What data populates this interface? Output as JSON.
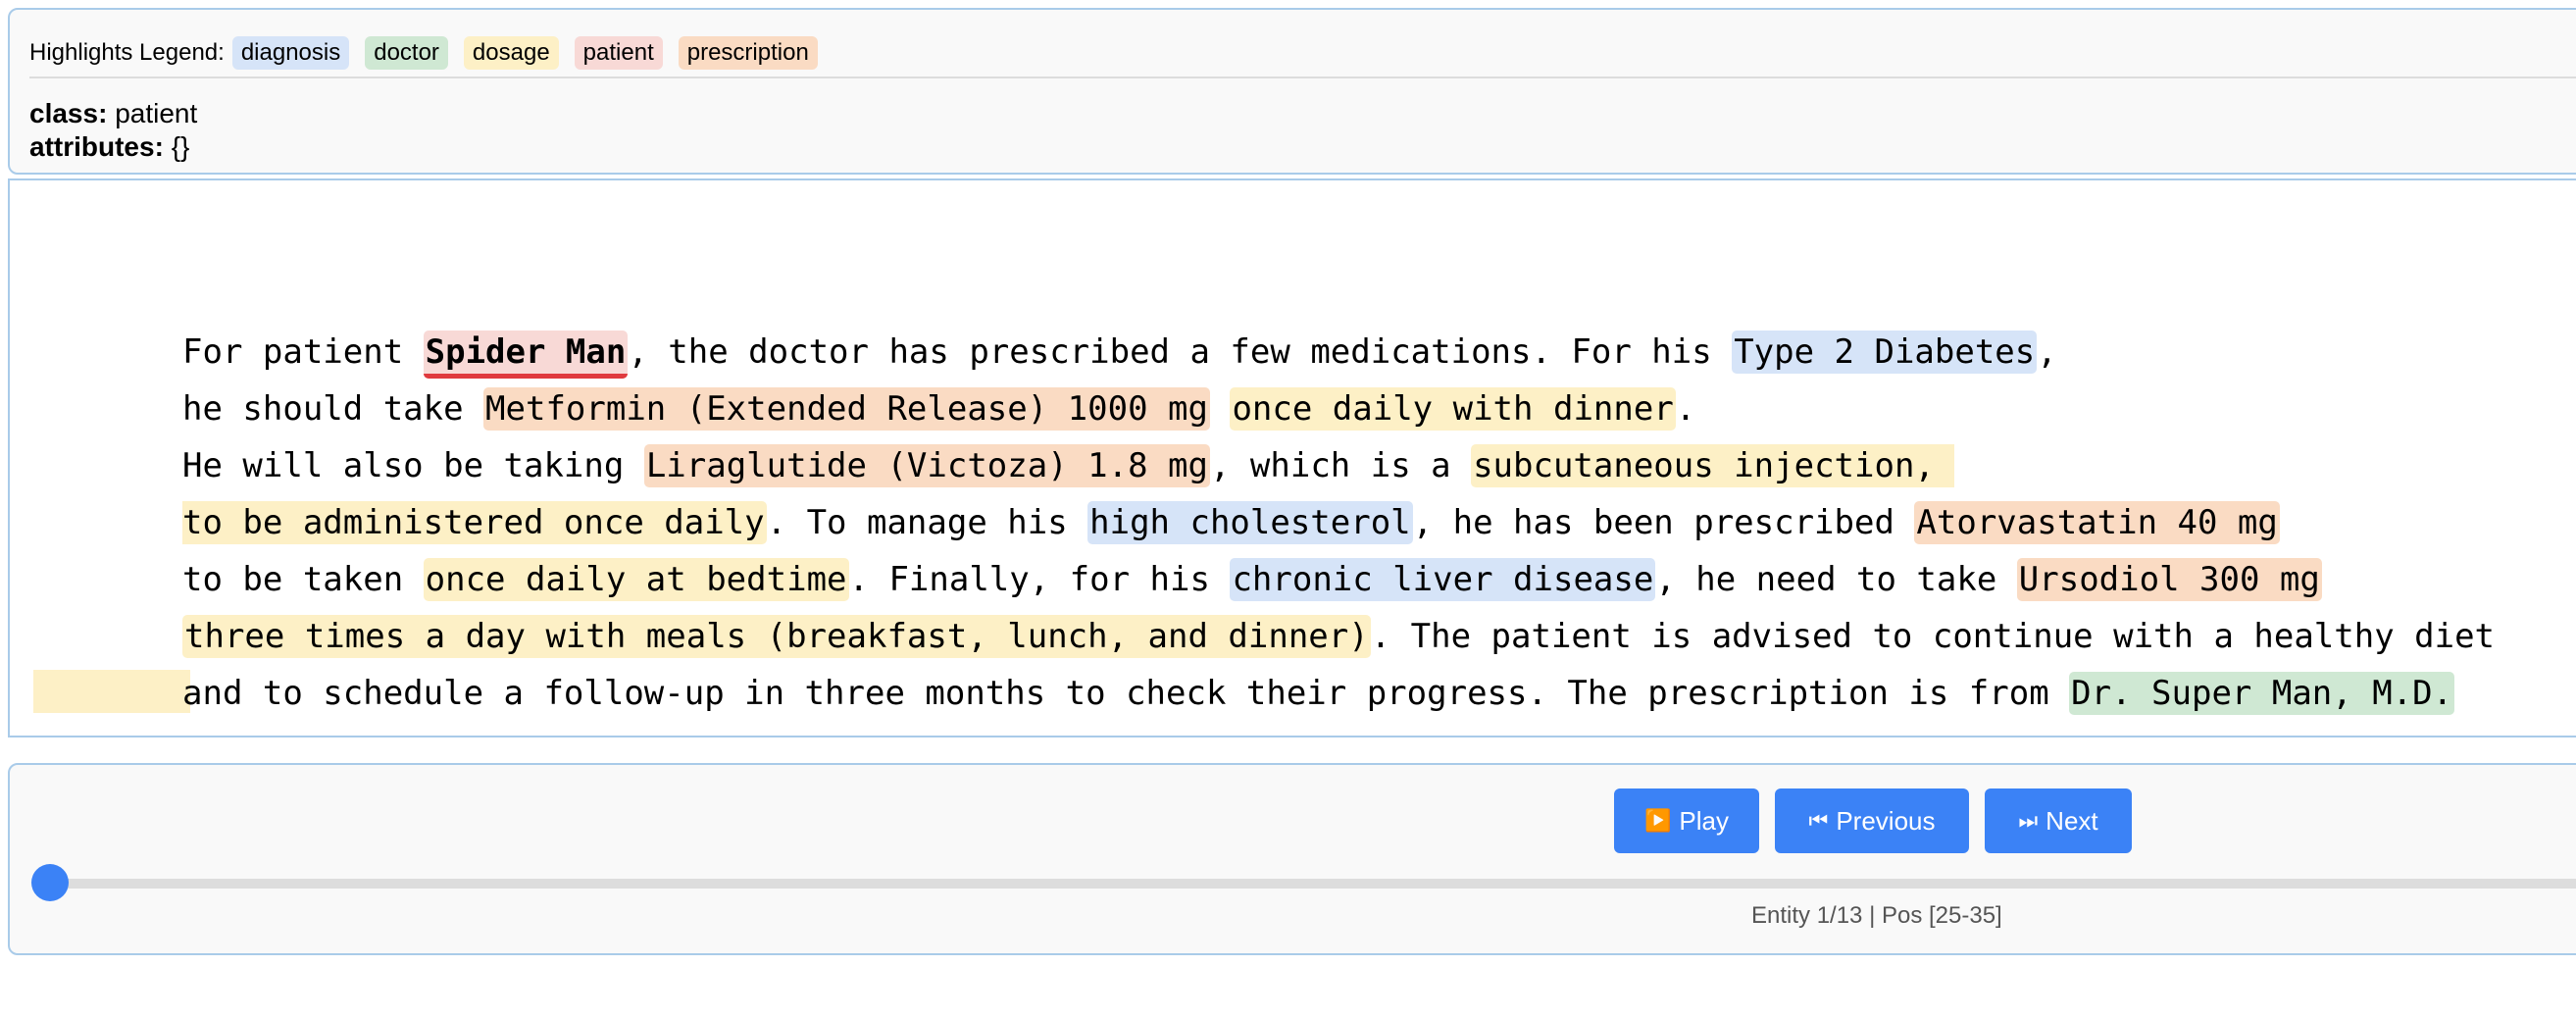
{
  "legend": {
    "title": "Highlights Legend:",
    "items": [
      {
        "label": "diagnosis",
        "color": "#d6e4f8"
      },
      {
        "label": "doctor",
        "color": "#cfe8d3"
      },
      {
        "label": "dosage",
        "color": "#fdf0c6"
      },
      {
        "label": "patient",
        "color": "#f8d9d6"
      },
      {
        "label": "prescription",
        "color": "#fadbc3"
      }
    ]
  },
  "info": {
    "class_label": "class:",
    "class_value": "patient",
    "attributes_label": "attributes:",
    "attributes_value": "{}"
  },
  "text": {
    "seg_01": "For patient ",
    "ent_01": "Spider Man",
    "seg_02": ", the doctor has prescribed a few medications. For his ",
    "ent_02": "Type 2 Diabetes",
    "seg_03": ",\nhe should take ",
    "ent_03": "Metformin (Extended Release) 1000 mg",
    "seg_04": " ",
    "ent_04": "once daily with dinner",
    "seg_05": ".\nHe will also be taking ",
    "ent_05": "Liraglutide (Victoza) 1.8 mg",
    "seg_06": ", which is a ",
    "ent_06": "subcutaneous injection, \nto be administered once daily",
    "seg_07": ". To manage his ",
    "ent_07": "high cholesterol",
    "seg_08": ", he has been prescribed ",
    "ent_08": "Atorvastatin 40 mg",
    "seg_09": "\nto be taken ",
    "ent_09": "once daily at bedtime",
    "seg_10": ". Finally, for his ",
    "ent_10": "chronic liver disease",
    "seg_11": ", he need to take ",
    "ent_11": "Ursodiol 300 mg",
    "seg_12": "\n",
    "ent_12": "three times a day with meals (breakfast, lunch, and dinner)",
    "seg_13": ". The patient is advised to continue with a healthy diet\nand to schedule a follow-up in three months to check their progress. The prescription is from ",
    "ent_13": "Dr. Super Man, M.D."
  },
  "controls": {
    "play_label": "Play",
    "play_icon": "play-icon",
    "prev_label": "Previous",
    "prev_icon": "skip-previous-icon",
    "next_label": "Next",
    "next_icon": "skip-next-icon",
    "slider_fraction": 0.0,
    "status": "Entity 1/13 | Pos [25-35]"
  },
  "colors": {
    "accent": "#3b82f6",
    "active_underline": "#e03a3e",
    "panel_border": "#a9cbe9"
  }
}
